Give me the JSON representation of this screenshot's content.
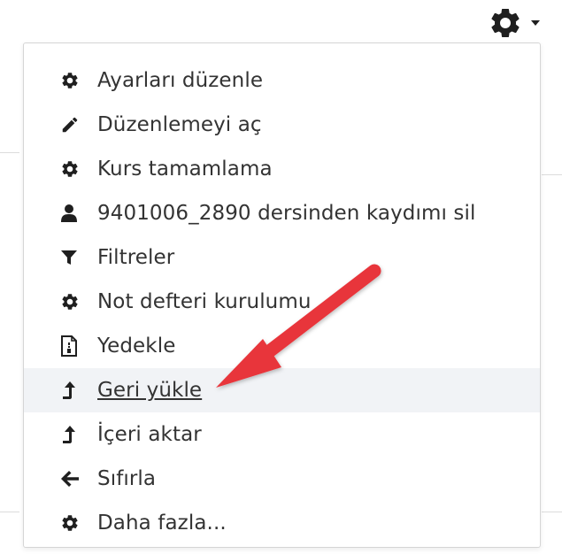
{
  "header": {
    "settings_icon": "gear-icon",
    "dropdown_icon": "caret-down-icon"
  },
  "menu": {
    "items": [
      {
        "label": "Ayarları düzenle",
        "icon": "gear-icon"
      },
      {
        "label": "Düzenlemeyi aç",
        "icon": "pencil-icon"
      },
      {
        "label": "Kurs tamamlama",
        "icon": "gear-icon"
      },
      {
        "label": "9401006_2890 dersinden kaydımı sil",
        "icon": "user-icon"
      },
      {
        "label": "Filtreler",
        "icon": "filter-icon"
      },
      {
        "label": "Not defteri kurulumu",
        "icon": "gear-icon"
      },
      {
        "label": "Yedekle",
        "icon": "backup-file-icon"
      },
      {
        "label": "Geri yükle",
        "icon": "upload-arrow-icon",
        "highlighted": true
      },
      {
        "label": "İçeri aktar",
        "icon": "upload-arrow-icon"
      },
      {
        "label": "Sıfırla",
        "icon": "arrow-left-icon"
      },
      {
        "label": "Daha fazla...",
        "icon": "gear-icon"
      }
    ]
  },
  "annotation": {
    "type": "red-arrow",
    "target": "Geri yükle",
    "color": "#e8353a"
  },
  "colors": {
    "text": "#333333",
    "icon": "#1f1f1f",
    "hover_bg": "#f1f3f6",
    "border": "#d5d5d5",
    "arrow": "#e8353a"
  }
}
